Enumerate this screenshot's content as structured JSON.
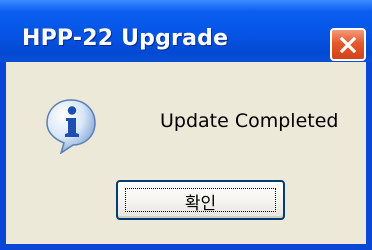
{
  "window": {
    "title": "HPP-22 Upgrade",
    "close_icon": "close-icon"
  },
  "dialog": {
    "icon": "information-icon",
    "message": "Update Completed"
  },
  "buttons": {
    "ok_label": "확인"
  },
  "colors": {
    "titlebar": "#0654e4",
    "client_bg": "#ece9d8",
    "close_button": "#e45a2c",
    "button_border": "#003c74"
  }
}
